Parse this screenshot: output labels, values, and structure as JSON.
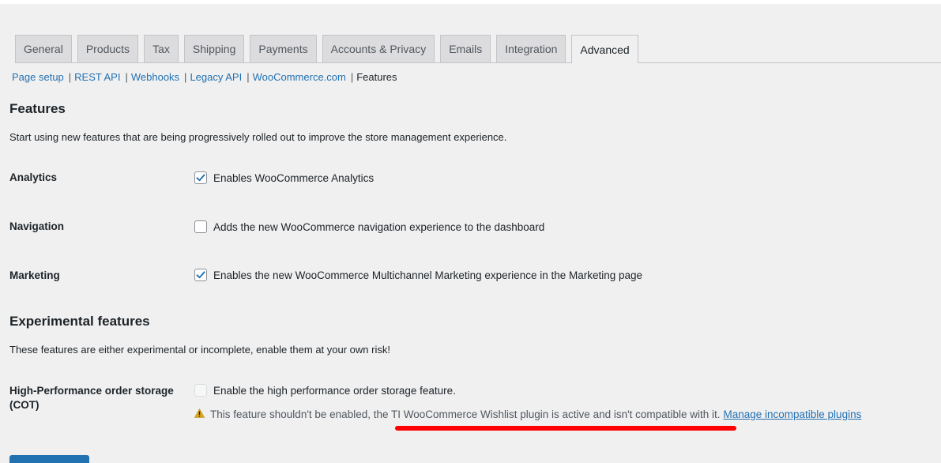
{
  "tabs": [
    {
      "label": "General"
    },
    {
      "label": "Products"
    },
    {
      "label": "Tax"
    },
    {
      "label": "Shipping"
    },
    {
      "label": "Payments"
    },
    {
      "label": "Accounts & Privacy"
    },
    {
      "label": "Emails"
    },
    {
      "label": "Integration"
    },
    {
      "label": "Advanced",
      "active": true
    }
  ],
  "subnav": {
    "items": [
      "Page setup",
      "REST API",
      "Webhooks",
      "Legacy API",
      "WooCommerce.com"
    ],
    "separator": "|",
    "current": "Features"
  },
  "features": {
    "heading": "Features",
    "description": "Start using new features that are being progressively rolled out to improve the store management experience.",
    "analytics": {
      "label": "Analytics",
      "text": "Enables WooCommerce Analytics",
      "checked": true
    },
    "navigation": {
      "label": "Navigation",
      "text": "Adds the new WooCommerce navigation experience to the dashboard",
      "checked": false
    },
    "marketing": {
      "label": "Marketing",
      "text": "Enables the new WooCommerce Multichannel Marketing experience in the Marketing page",
      "checked": true
    }
  },
  "experimental": {
    "heading": "Experimental features",
    "description": "These features are either experimental or incomplete, enable them at your own risk!",
    "cot": {
      "label": "High-Performance order storage (COT)",
      "text": "Enable the high performance order storage feature.",
      "checked": false,
      "disabled": true,
      "warning": "This feature shouldn't be enabled, the TI WooCommerce Wishlist plugin is active and isn't compatible with it.",
      "link": "Manage incompatible plugins"
    }
  },
  "colors": {
    "link": "#2271b1",
    "checkmark": "#2271b1",
    "annotation": "#ff0000",
    "warning_icon": "#dba617"
  }
}
